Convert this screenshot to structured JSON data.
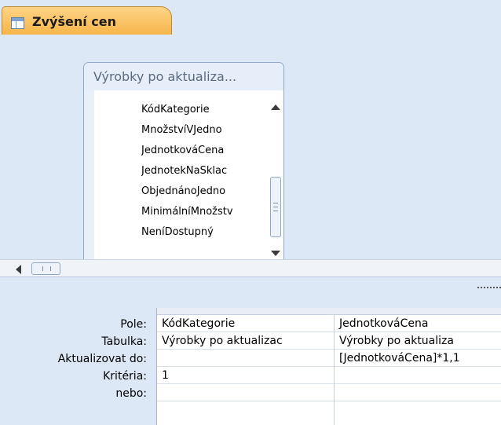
{
  "tab": {
    "title": "Zvýšení cen",
    "icon": "query-icon"
  },
  "table": {
    "title": "Výrobky po aktualiza...",
    "fields": [
      "KódKategorie",
      "MnožstvíVJedno",
      "JednotkováCena",
      "JednotekNaSklac",
      "ObjednánoJedno",
      "MinimálníMnožstv",
      "NeníDostupný"
    ]
  },
  "grid": {
    "row_labels": [
      "Pole:",
      "Tabulka:",
      "Aktualizovat do:",
      "Kritéria:",
      "nebo:"
    ],
    "columns": [
      {
        "pole": "KódKategorie",
        "tabulka": "Výrobky po aktualizac",
        "aktualizovat": "",
        "kriteria": "1",
        "nebo": ""
      },
      {
        "pole": "JednotkováCena",
        "tabulka": "Výrobky po aktualiza",
        "aktualizovat": "[JednotkováCena]*1,1",
        "kriteria": "",
        "nebo": ""
      }
    ]
  },
  "colors": {
    "tab": "#f6b447",
    "background": "#dce8f6"
  }
}
